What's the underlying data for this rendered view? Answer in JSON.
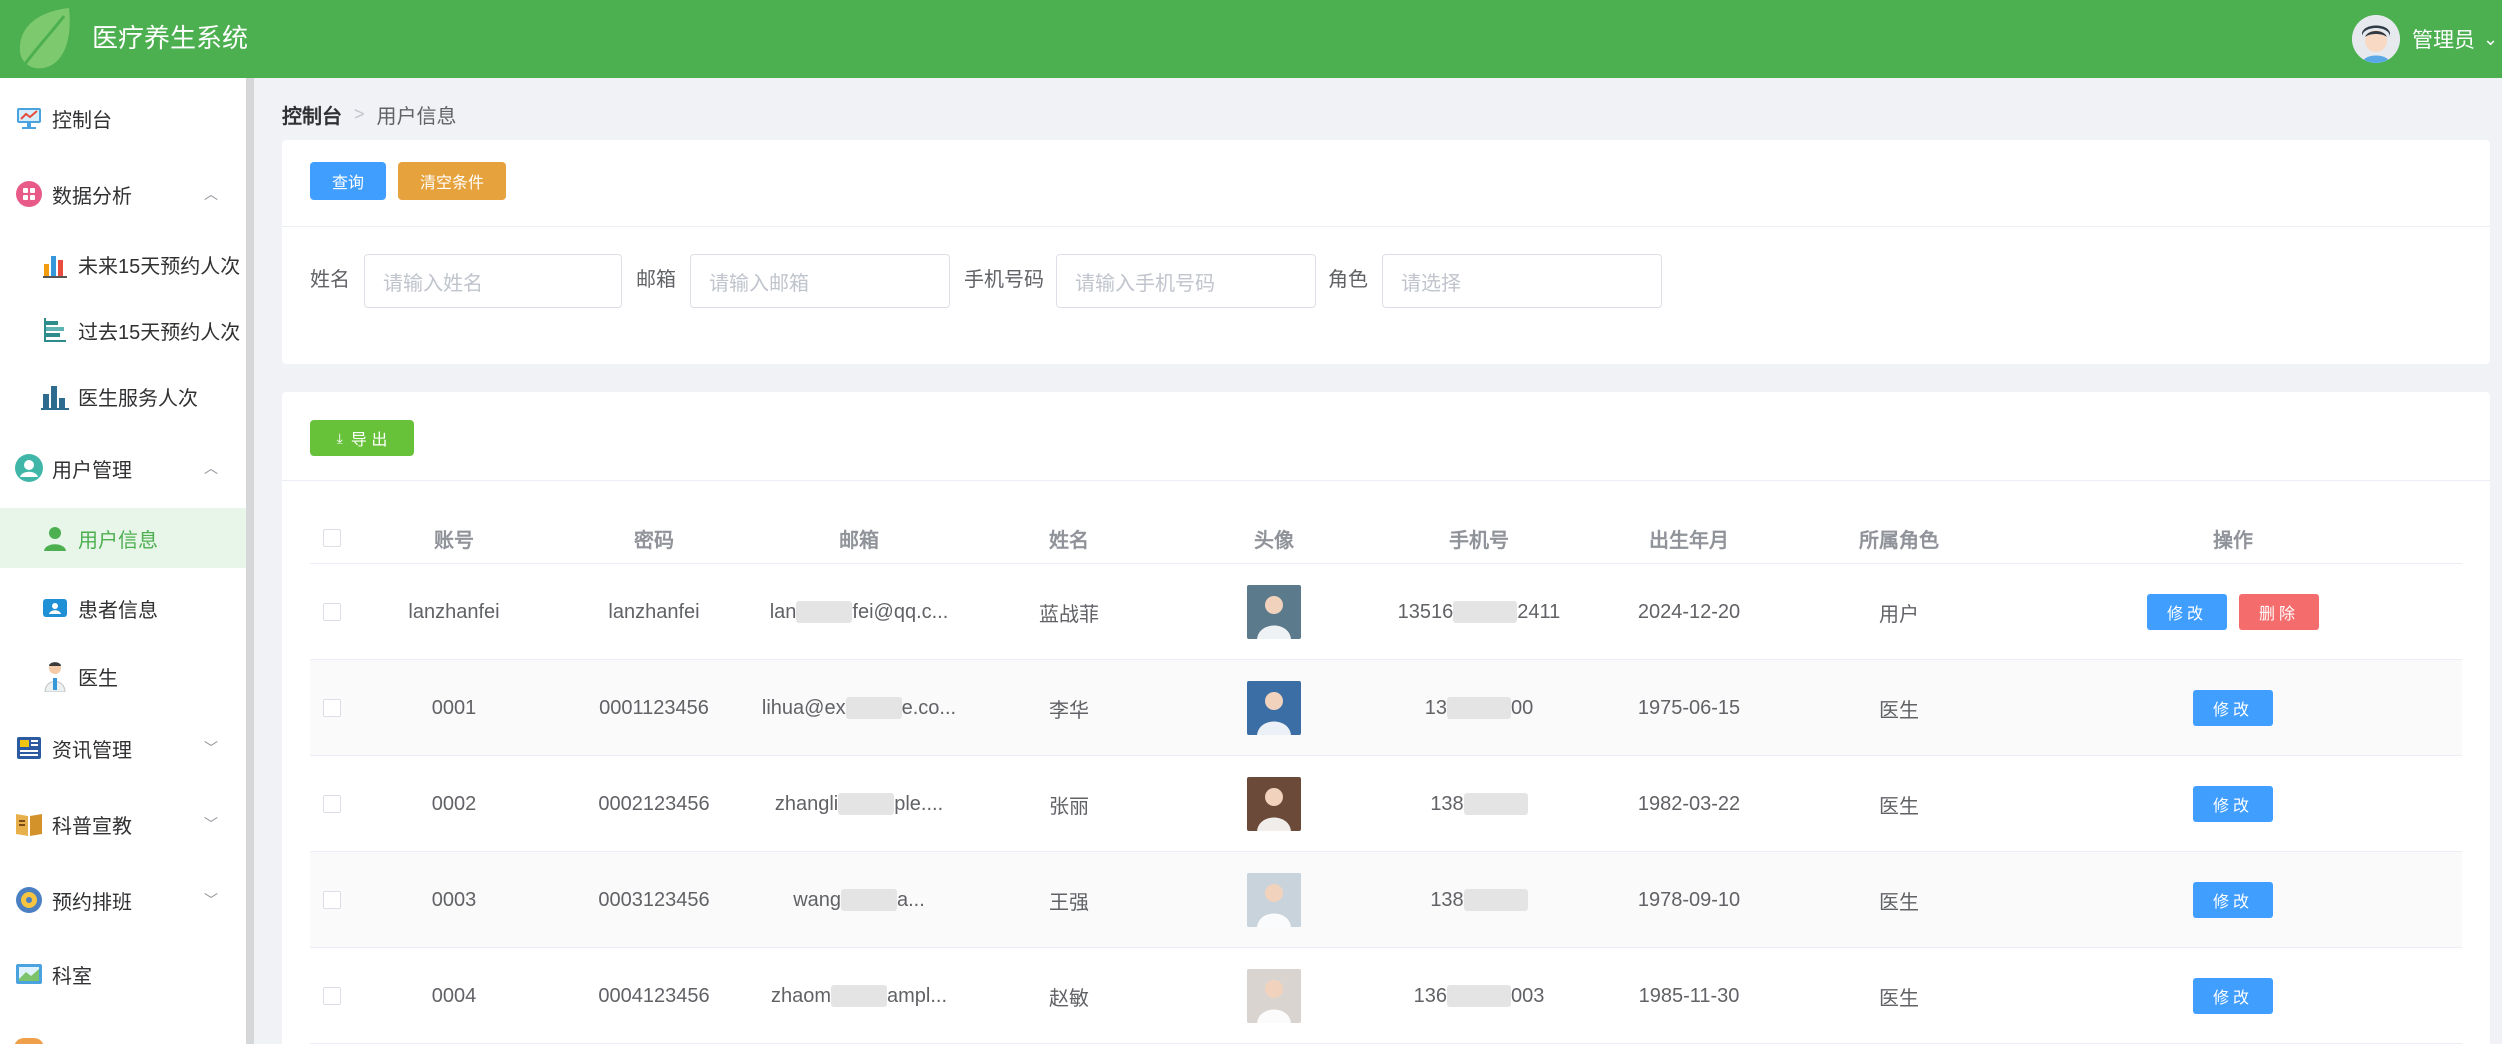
{
  "header": {
    "app_title": "医疗养生系统",
    "user_name": "管理员",
    "caret": "⌵"
  },
  "colors": {
    "brand": "#4caf50",
    "primary": "#409eff",
    "warning": "#e6a23c",
    "success": "#67c23a",
    "danger": "#f56c6c"
  },
  "sidebar": {
    "items": [
      {
        "label": "控制台",
        "icon": "monitor-icon"
      },
      {
        "label": "数据分析",
        "icon": "dashboard-icon",
        "expanded": true
      },
      {
        "label": "未来15天预约人次",
        "icon": "bar-chart-icon"
      },
      {
        "label": "过去15天预约人次",
        "icon": "hbar-chart-icon"
      },
      {
        "label": "医生服务人次",
        "icon": "column-chart-icon"
      },
      {
        "label": "用户管理",
        "icon": "user-circle-icon",
        "expanded": true
      },
      {
        "label": "用户信息",
        "icon": "user-icon",
        "active": true
      },
      {
        "label": "患者信息",
        "icon": "id-card-icon"
      },
      {
        "label": "医生",
        "icon": "doctor-icon"
      },
      {
        "label": "资讯管理",
        "icon": "news-icon",
        "expanded": false
      },
      {
        "label": "科普宣教",
        "icon": "book-icon",
        "expanded": false
      },
      {
        "label": "预约排班",
        "icon": "schedule-icon",
        "expanded": false
      },
      {
        "label": "科室",
        "icon": "department-icon"
      }
    ]
  },
  "breadcrumb": {
    "home": "控制台",
    "separator": ">",
    "current": "用户信息"
  },
  "search": {
    "query_label": "查询",
    "clear_label": "清空条件",
    "fields": [
      {
        "label": "姓名",
        "placeholder": "请输入姓名"
      },
      {
        "label": "邮箱",
        "placeholder": "请输入邮箱"
      },
      {
        "label": "手机号码",
        "placeholder": "请输入手机号码"
      },
      {
        "label": "角色",
        "placeholder": "请选择"
      }
    ]
  },
  "table": {
    "export_label": "导 出",
    "columns": [
      "账号",
      "密码",
      "邮箱",
      "姓名",
      "头像",
      "手机号",
      "出生年月",
      "所属角色",
      "操作"
    ],
    "edit_label": "修改",
    "delete_label": "删除",
    "rows": [
      {
        "account": "lanzhanfei",
        "password": "lanzhanfei",
        "email_a": "lan",
        "email_b": "fei@qq.c...",
        "name": "蓝战菲",
        "phone_a": "13516",
        "phone_b": "2411",
        "birth": "2024-12-20",
        "role": "用户",
        "deletable": true,
        "photo_color": "#5b7a8c"
      },
      {
        "account": "0001",
        "password": "0001123456",
        "email_a": "lihua@ex",
        "email_b": "e.co...",
        "name": "李华",
        "phone_a": "13",
        "phone_b": "00",
        "birth": "1975-06-15",
        "role": "医生",
        "deletable": false,
        "photo_color": "#3a6ea5"
      },
      {
        "account": "0002",
        "password": "0002123456",
        "email_a": "zhangli",
        "email_b": "ple....",
        "name": "张丽",
        "phone_a": "138",
        "phone_b": "",
        "birth": "1982-03-22",
        "role": "医生",
        "deletable": false,
        "photo_color": "#6b4a3a"
      },
      {
        "account": "0003",
        "password": "0003123456",
        "email_a": "wang",
        "email_b": "a...",
        "name": "王强",
        "phone_a": "138",
        "phone_b": "",
        "birth": "1978-09-10",
        "role": "医生",
        "deletable": false,
        "photo_color": "#c9d3db"
      },
      {
        "account": "0004",
        "password": "0004123456",
        "email_a": "zhaom",
        "email_b": "ampl...",
        "name": "赵敏",
        "phone_a": "136",
        "phone_b": "003",
        "birth": "1985-11-30",
        "role": "医生",
        "deletable": false,
        "photo_color": "#d9d4d0"
      }
    ]
  }
}
